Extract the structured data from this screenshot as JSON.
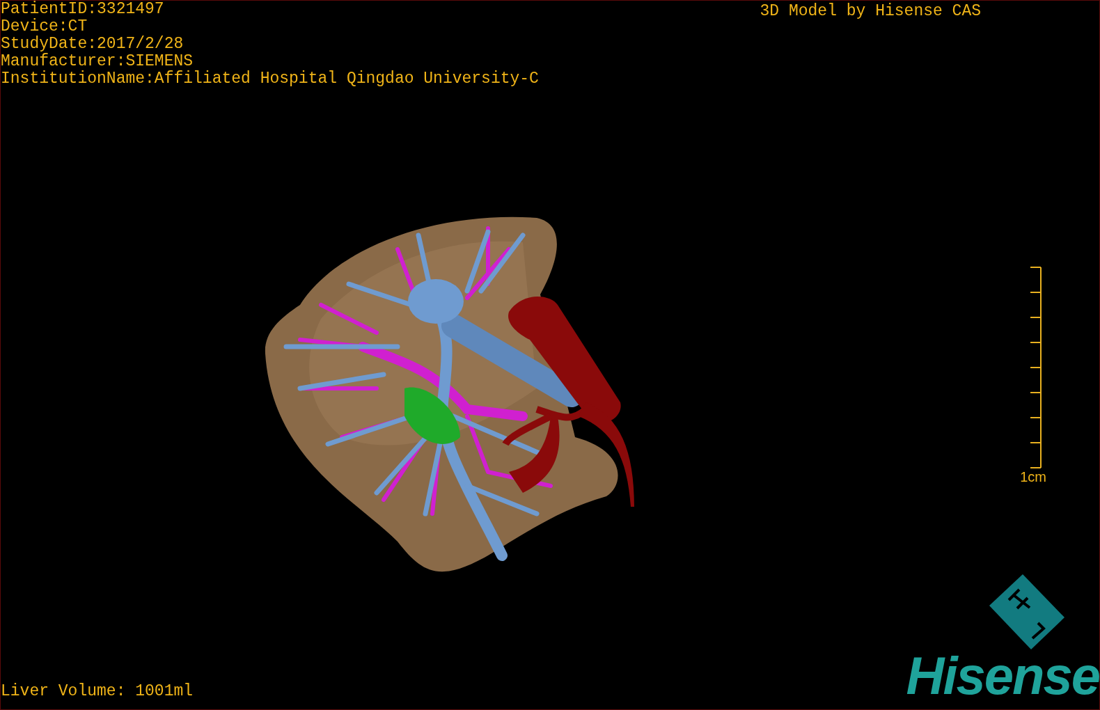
{
  "info_lines": [
    "PatientID:3321497",
    "Device:CT",
    "StudyDate:2017/2/28",
    "Manufacturer:SIEMENS",
    "InstitutionName:Affiliated Hospital Qingdao University-C"
  ],
  "model_credit": "3D Model by Hisense CAS",
  "scale_bar": {
    "label": "1cm"
  },
  "liver_volume": "Liver Volume: 1001ml",
  "logo": {
    "wordmark": "Hisense"
  }
}
